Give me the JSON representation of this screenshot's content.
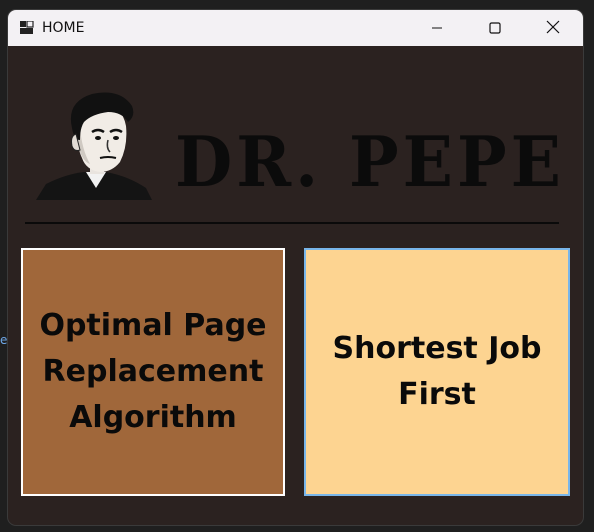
{
  "window": {
    "title": "HOME",
    "app_icon": "app-window-icon",
    "controls": {
      "minimize_icon": "minimize-icon",
      "maximize_icon": "maximize-icon",
      "close_icon": "close-icon"
    }
  },
  "header": {
    "logo_text": "DR. PEPE",
    "portrait": "portrait-image"
  },
  "menu": {
    "items": [
      {
        "label": "Optimal Page Replacement Algorithm",
        "color": "#a0673a"
      },
      {
        "label": "Shortest Job First",
        "color": "#fdd491"
      }
    ]
  },
  "desktop": {
    "edge_glyph": "e"
  },
  "colors": {
    "window_bg": "#2b2220",
    "titlebar_bg": "#f3f1f4",
    "text": "#0a0a0a"
  }
}
